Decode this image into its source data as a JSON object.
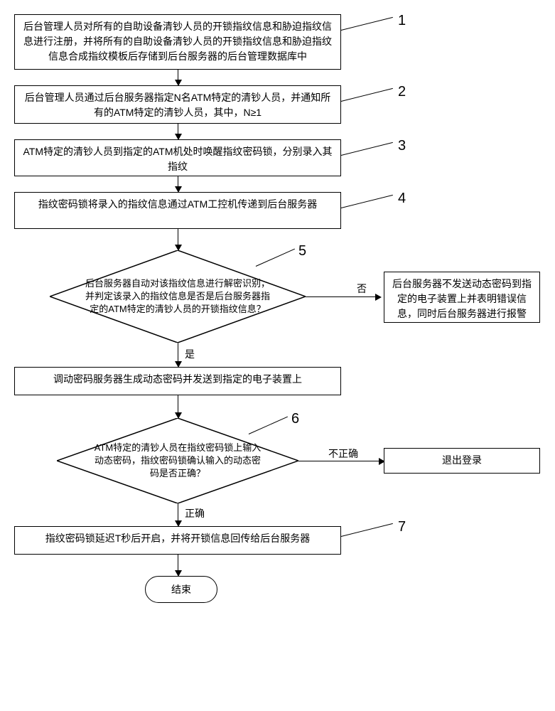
{
  "steps": {
    "s1": "后台管理人员对所有的自助设备清钞人员的开锁指纹信息和胁迫指纹信息进行注册，并将所有的自助设备清钞人员的开锁指纹信息和胁迫指纹信息合成指纹模板后存储到后台服务器的后台管理数据库中",
    "s2": "后台管理人员通过后台服务器指定N名ATM特定的清钞人员，并通知所有的ATM特定的清钞人员，其中，N≥1",
    "s3": "ATM特定的清钞人员到指定的ATM机处时唤醒指纹密码锁，分别录入其指纹",
    "s4": "指纹密码锁将录入的指纹信息通过ATM工控机传递到后台服务器",
    "s5": "后台服务器自动对该指纹信息进行解密识别，并判定该录入的指纹信息是否是后台服务器指定的ATM特定的清钞人员的开锁指纹信息？",
    "s5_no": "后台服务器不发送动态密码到指定的电子装置上并表明错误信息，同时后台服务器进行报警",
    "s5_yes_action": "调动密码服务器生成动态密码并发送到指定的电子装置上",
    "s6": "ATM特定的清钞人员在指纹密码锁上输入动态密码，指纹密码锁确认输入的动态密码是否正确？",
    "s6_no": "退出登录",
    "s7": "指纹密码锁延迟T秒后开启，并将开锁信息回传给后台服务器"
  },
  "labels": {
    "n1": "1",
    "n2": "2",
    "n3": "3",
    "n4": "4",
    "n5": "5",
    "n6": "6",
    "n7": "7",
    "yes": "是",
    "no": "否",
    "correct": "正确",
    "incorrect": "不正确",
    "end": "结束"
  }
}
